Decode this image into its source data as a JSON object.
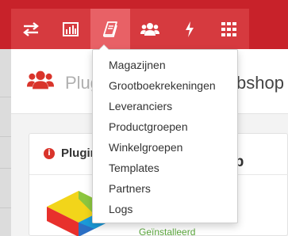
{
  "toolbar": {
    "tabs": [
      {
        "icon": "exchange-arrows-icon"
      },
      {
        "icon": "bar-chart-icon"
      },
      {
        "icon": "book-icon",
        "active": true
      },
      {
        "icon": "users-icon"
      },
      {
        "icon": "lightning-bolt-icon"
      },
      {
        "icon": "grid-icon"
      }
    ],
    "colors": {
      "bar": "#c8222a",
      "tab": "#d63a3f",
      "active_tab": "#e86166"
    }
  },
  "dropdown": {
    "items": [
      {
        "label": "Magazijnen"
      },
      {
        "label": "Grootboekrekeningen"
      },
      {
        "label": "Leveranciers"
      },
      {
        "label": "Productgroepen"
      },
      {
        "label": "Winkelgroepen"
      },
      {
        "label": "Templates"
      },
      {
        "label": "Partners"
      },
      {
        "label": "Logs"
      }
    ]
  },
  "header": {
    "icon": "users-icon",
    "title_start": "Plug",
    "title_end": "bshop"
  },
  "card": {
    "icon": "info-icon",
    "icon_glyph": "i",
    "title": "Plugin",
    "plugin_name_fragment": "shop",
    "status": "Geïnstalleerd",
    "status_color": "#5aa63c"
  }
}
